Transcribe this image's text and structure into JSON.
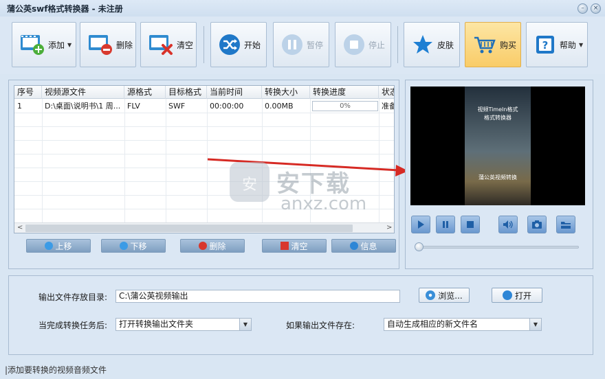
{
  "window": {
    "title": "蒲公英swf格式转换器 - 未注册"
  },
  "toolbar": {
    "add": "添加",
    "delete": "删除",
    "clear": "清空",
    "start": "开始",
    "pause": "暂停",
    "stop": "停止",
    "skin": "皮肤",
    "buy": "购买",
    "help": "帮助"
  },
  "table": {
    "columns": [
      "序号",
      "视频源文件",
      "源格式",
      "目标格式",
      "当前时间",
      "转换大小",
      "转换进度",
      "状态"
    ],
    "rows": [
      {
        "index": "1",
        "source": "D:\\桌面\\说明书\\1 周...",
        "src_format": "FLV",
        "dst_format": "SWF",
        "time": "00:00:00",
        "size": "0.00MB",
        "progress": "0%",
        "status": "准备"
      }
    ]
  },
  "list_buttons": {
    "up": "上移",
    "down": "下移",
    "delete": "删除",
    "clear": "清空",
    "info": "信息"
  },
  "preview": {
    "overlay_top": "视频TimeIn格式",
    "overlay_mid": "格式转换器",
    "overlay_bottom": "蒲公英视频转换"
  },
  "watermark": {
    "main": "安下载",
    "sub": "anxz.com"
  },
  "output": {
    "dir_label": "输出文件存放目录:",
    "dir_value": "C:\\蒲公英视频输出",
    "browse": "浏览...",
    "open": "打开",
    "after_label": "当完成转换任务后:",
    "after_value": "打开转换输出文件夹",
    "exists_label": "如果输出文件存在:",
    "exists_value": "自动生成相应的新文件名"
  },
  "status_text": "|添加要转换的视频音频文件",
  "colors": {
    "accent": "#f9cc68",
    "toolbar_bg": "#dbe7f4",
    "list_button": "#8aa8c8"
  }
}
